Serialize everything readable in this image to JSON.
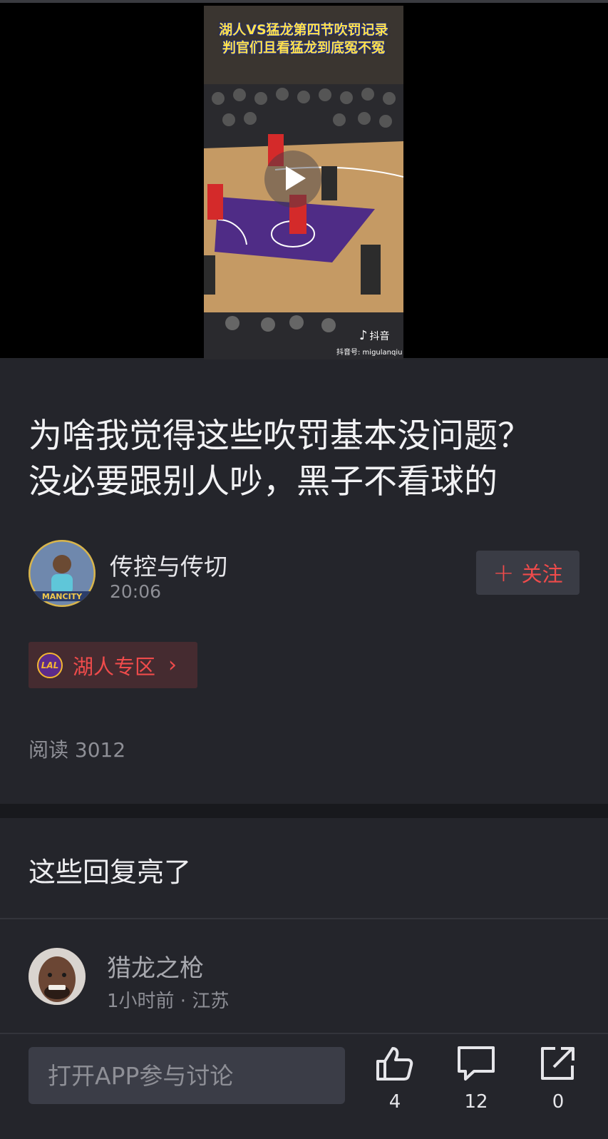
{
  "video": {
    "caption_line1": "湖人VS猛龙第四节吹罚记录",
    "caption_line2": "判官们且看猛龙到底冤不冤",
    "platform_label": "抖音",
    "account_id": "抖音号: migulanqiu",
    "icons": {
      "play": "play-icon",
      "platform": "tiktok-icon"
    }
  },
  "post": {
    "title_line1": "为啥我觉得这些吹罚基本没问题？",
    "title_line2": "没必要跟别人吵，黑子不看球的"
  },
  "author": {
    "name": "传控与传切",
    "time": "20:06",
    "avatar_text": "MANCITY",
    "follow_label": "关注",
    "follow_icon": "+"
  },
  "zone": {
    "label": "湖人专区",
    "logo_text": "LAL",
    "arrow": "›"
  },
  "stats": {
    "read_count": "阅读 3012"
  },
  "comments_section": {
    "title": "这些回复亮了",
    "comments": [
      {
        "user": "猎龙之枪",
        "meta": "1小时前 · 江苏"
      }
    ]
  },
  "bottom_bar": {
    "input_placeholder": "打开APP参与讨论",
    "like_count": "4",
    "comment_count": "12",
    "share_count": "0"
  },
  "colors": {
    "background": "#24252b",
    "accent_red": "#ef4b4b",
    "muted_text": "#8e8f96",
    "button_bg": "#3a3c45"
  }
}
